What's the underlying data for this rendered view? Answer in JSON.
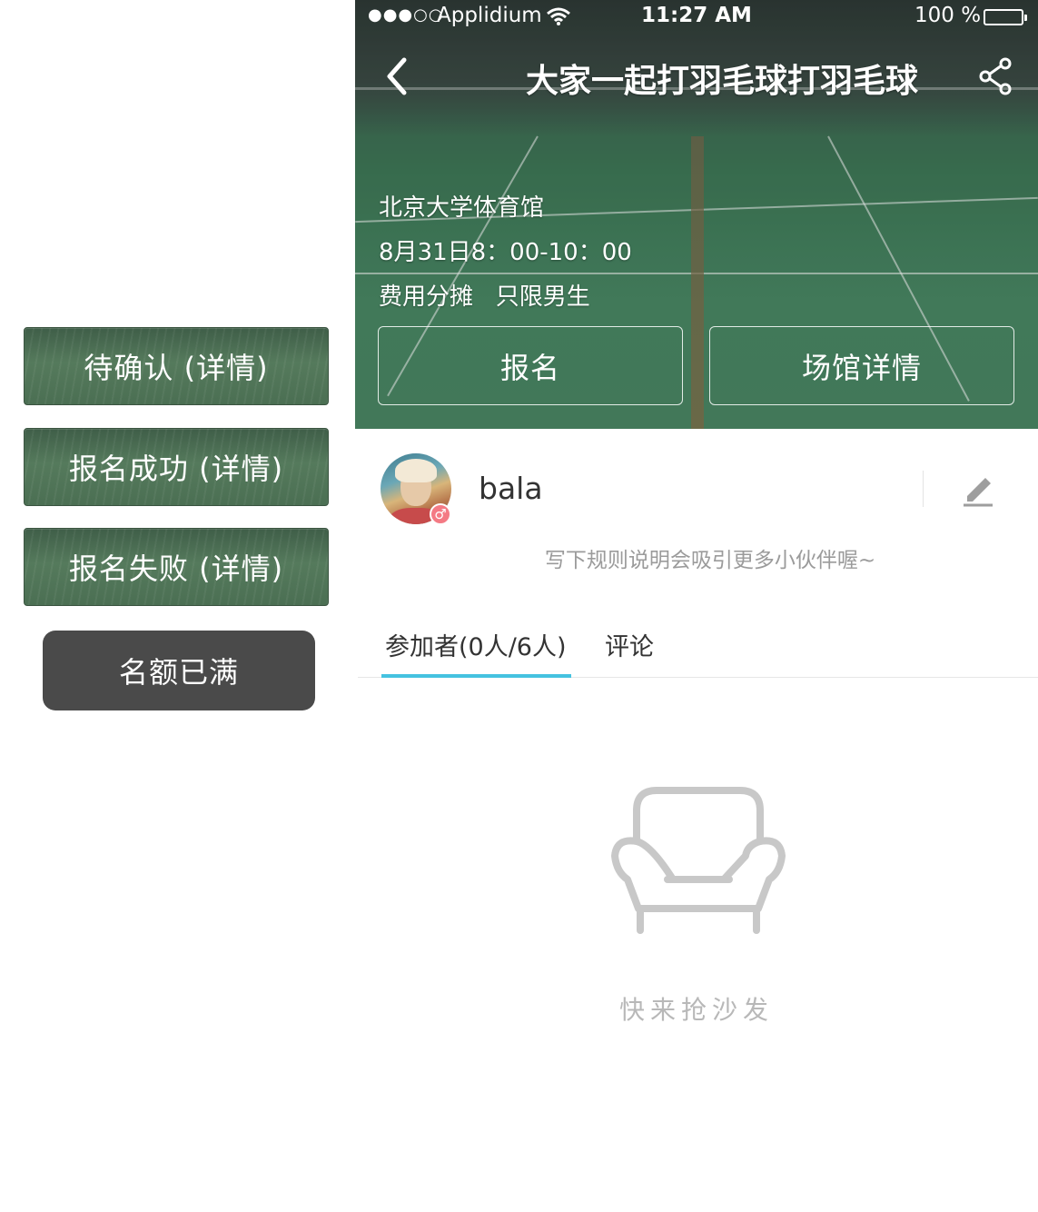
{
  "side_states": {
    "pending": "待确认 (详情)",
    "success": "报名成功 (详情)",
    "failed": "报名失败 (详情)",
    "full": "名额已满"
  },
  "status_bar": {
    "signal": "●●●○○",
    "carrier": "Applidium",
    "time": "11:27 AM",
    "battery": "100 %"
  },
  "header": {
    "title": "大家一起打羽毛球打羽毛球"
  },
  "event": {
    "venue": "北京大学体育馆",
    "datetime": "8月31日8：00-10：00",
    "fee_gender": "费用分摊   只限男生",
    "signup_label": "报名",
    "venue_details_label": "场馆详情"
  },
  "organizer": {
    "name": "bala",
    "gender_symbol": "♂",
    "rules_placeholder": "写下规则说明会吸引更多小伙伴喔~"
  },
  "tabs": [
    {
      "label": "参加者(0人/6人)",
      "active": true
    },
    {
      "label": "评论",
      "active": false
    }
  ],
  "empty_state": {
    "icon": "sofa-icon",
    "text": "快来抢沙发"
  },
  "colors": {
    "tab_accent": "#45c2e0",
    "full_button": "#4a4a4a",
    "gender_badge": "#f47a84"
  }
}
